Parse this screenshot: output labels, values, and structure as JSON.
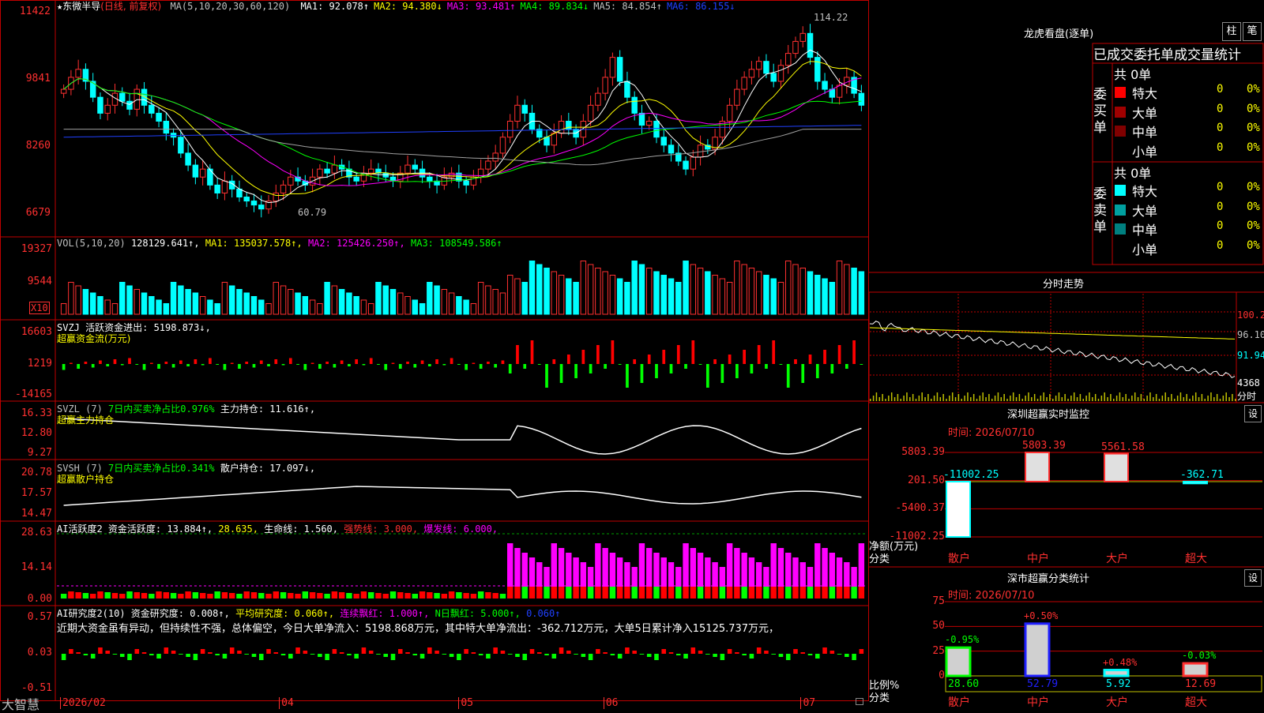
{
  "main_chart": {
    "title_prefix": "★",
    "stock_name": "东微半导",
    "mode": "(日线, 前复权)",
    "ma_label": "MA(5,10,20,30,60,120)",
    "ma_values": [
      {
        "label": "MA1: 92.078",
        "arrow": "↑",
        "color": "#ffffff"
      },
      {
        "label": "MA2: 94.380",
        "arrow": "↓",
        "color": "#ffff00"
      },
      {
        "label": "MA3: 93.481",
        "arrow": "↑",
        "color": "#ff00ff"
      },
      {
        "label": "MA4: 89.834",
        "arrow": "↓",
        "color": "#00ff00"
      },
      {
        "label": "MA5: 84.854",
        "arrow": "↑",
        "color": "#c0c0c0"
      },
      {
        "label": "MA6: 86.155",
        "arrow": "↓",
        "color": "#2040ff"
      }
    ],
    "price_ticks": [
      "11422",
      "9841",
      "8260",
      "6679"
    ],
    "high_label": "114.22",
    "low_label": "60.79"
  },
  "vol_panel": {
    "label": "VOL(5,10,20)",
    "value": "128129.641↑,",
    "ma1": "MA1: 135037.578↑,",
    "ma2": "MA2: 125426.250↑,",
    "ma3": "MA3: 108549.586↑",
    "ticks": [
      "19327",
      "9544"
    ],
    "unit": "X10"
  },
  "svzj_panel": {
    "label": "SVZJ  活跃资金进出: 5198.873↓,",
    "sub": "超赢资金流(万元)",
    "ticks": [
      "16603",
      "1219",
      "-14165"
    ]
  },
  "svzl_panel": {
    "label": "SVZL (7)",
    "ratio": "7日内买卖净占比0.976%",
    "main": "主力持仓: 11.616↑,",
    "sub": "超赢主力持仓",
    "ticks": [
      "16.33",
      "12.80",
      "9.27"
    ]
  },
  "svsh_panel": {
    "label": "SVSH (7)",
    "ratio": "7日内买卖净占比0.341%",
    "main": "散户持仓: 17.097↓,",
    "sub": "超赢散户持仓",
    "ticks": [
      "20.78",
      "17.57",
      "14.47"
    ]
  },
  "ai1_panel": {
    "label": "AI活跃度2 资金活跃度: 13.884↑,",
    "v2": "28.635,",
    "life": "生命线: 1.560,",
    "strong": "强势线: 3.000,",
    "burst": "爆发线: 6.000,",
    "ticks": [
      "28.63",
      "14.14",
      "0.00"
    ]
  },
  "ai2_panel": {
    "label": "AI研究度2(10) 资金研究度: 0.008↑,",
    "avg": "平均研究度: 0.060↑,",
    "cont": "连续飘红: 1.000↑,",
    "nday": "N日飘红: 5.000↑,",
    "last": "0.060↑",
    "comment": "近期大资金虽有异动，但持续性不强，总体偏空，今日大单净流入：5198.868万元，其中特大单净流出：-362.712万元，大单5日累计净入15125.737万元，",
    "ticks": [
      "0.57",
      "0.03",
      "-0.51"
    ]
  },
  "date_axis": {
    "logo": "大智慧",
    "labels": [
      {
        "text": "2026/02",
        "frac": 0.0
      },
      {
        "text": "04",
        "frac": 0.272
      },
      {
        "text": "05",
        "frac": 0.495
      },
      {
        "text": "06",
        "frac": 0.675
      },
      {
        "text": "07",
        "frac": 0.92
      }
    ]
  },
  "sidebar": {
    "lhb_title": "龙虎看盘(逐单)",
    "btn_bar": "柱",
    "btn_pen": "笔",
    "tabs": "已成交委托单成交量统计",
    "buy_label": "委买单",
    "sell_label": "委卖单",
    "buy_total": "共 0单",
    "sell_total": "共 0单",
    "buy_rows": [
      {
        "name": "特大",
        "val": "0",
        "pct": "0%",
        "color": "#ff0000"
      },
      {
        "name": "大单",
        "val": "0",
        "pct": "0%",
        "color": "#a00000"
      },
      {
        "name": "中单",
        "val": "0",
        "pct": "0%",
        "color": "#800000"
      },
      {
        "name": "小单",
        "val": "0",
        "pct": "0%",
        "color": "#000000"
      }
    ],
    "sell_rows": [
      {
        "name": "特大",
        "val": "0",
        "pct": "0%",
        "color": "#00ffff"
      },
      {
        "name": "大单",
        "val": "0",
        "pct": "0%",
        "color": "#00a0a0"
      },
      {
        "name": "中单",
        "val": "0",
        "pct": "0%",
        "color": "#008080"
      },
      {
        "name": "小单",
        "val": "0",
        "pct": "0%",
        "color": "#000000"
      }
    ],
    "intraday_title": "分时走势",
    "intraday_ticks": [
      "100.2",
      "96.10",
      "91.94"
    ],
    "intraday_vol": "4368",
    "intraday_label": "分时",
    "monitor_title": "深圳超赢实时监控",
    "monitor_btn": "设",
    "monitor_time": "时间: 2026/07/10",
    "monitor_ticks": [
      "5803.39",
      "201.50",
      "-5400.37",
      "-11002.25"
    ],
    "monitor_axis_title": "净额(万元)",
    "monitor_axis_sub": "分类",
    "monitor_categories": [
      "散户",
      "中户",
      "大户",
      "超大"
    ],
    "monitor_values": [
      -11002.25,
      5803.39,
      5561.58,
      -362.71
    ],
    "monitor_value_labels": [
      "-11002.25",
      "5803.39",
      "5561.58",
      "-362.71"
    ],
    "stats_title": "深市超赢分类统计",
    "stats_btn": "设",
    "stats_time": "时间: 2026/07/10",
    "stats_ticks": [
      "75",
      "50",
      "25",
      "0"
    ],
    "stats_axis_title": "比例%",
    "stats_axis_sub": "分类",
    "stats_categories": [
      "散户",
      "中户",
      "大户",
      "超大"
    ],
    "stats_values": [
      28.6,
      52.79,
      5.92,
      12.69
    ],
    "stats_change_labels": [
      "-0.95%",
      "+0.50%",
      "+0.48%",
      "-0.03%"
    ]
  },
  "chart_data": {
    "type": "candlestick",
    "title": "东微半导",
    "x_start": "2026/02",
    "high": 114.22,
    "low": 60.79,
    "ylim": [
      60,
      116
    ],
    "close_approx": [
      96,
      99,
      101,
      98,
      94,
      90,
      92,
      95,
      93,
      91,
      96,
      92,
      90,
      88,
      85,
      84,
      80,
      77,
      74,
      76,
      72,
      70,
      73,
      71,
      69,
      68,
      67,
      66,
      68,
      70,
      72,
      74,
      73,
      72,
      74,
      76,
      75,
      77,
      76,
      74,
      73,
      75,
      76,
      75,
      74,
      73,
      75,
      77,
      76,
      74,
      73,
      72,
      74,
      75,
      73,
      72,
      74,
      76,
      78,
      80,
      84,
      88,
      92,
      90,
      86,
      84,
      82,
      85,
      88,
      86,
      84,
      88,
      92,
      95,
      99,
      104,
      98,
      94,
      90,
      87,
      88,
      84,
      82,
      80,
      78,
      76,
      79,
      82,
      81,
      84,
      88,
      92,
      96,
      99,
      101,
      103,
      100,
      98,
      102,
      105,
      108,
      110,
      104,
      98,
      96,
      94,
      97,
      99,
      95,
      92
    ]
  }
}
